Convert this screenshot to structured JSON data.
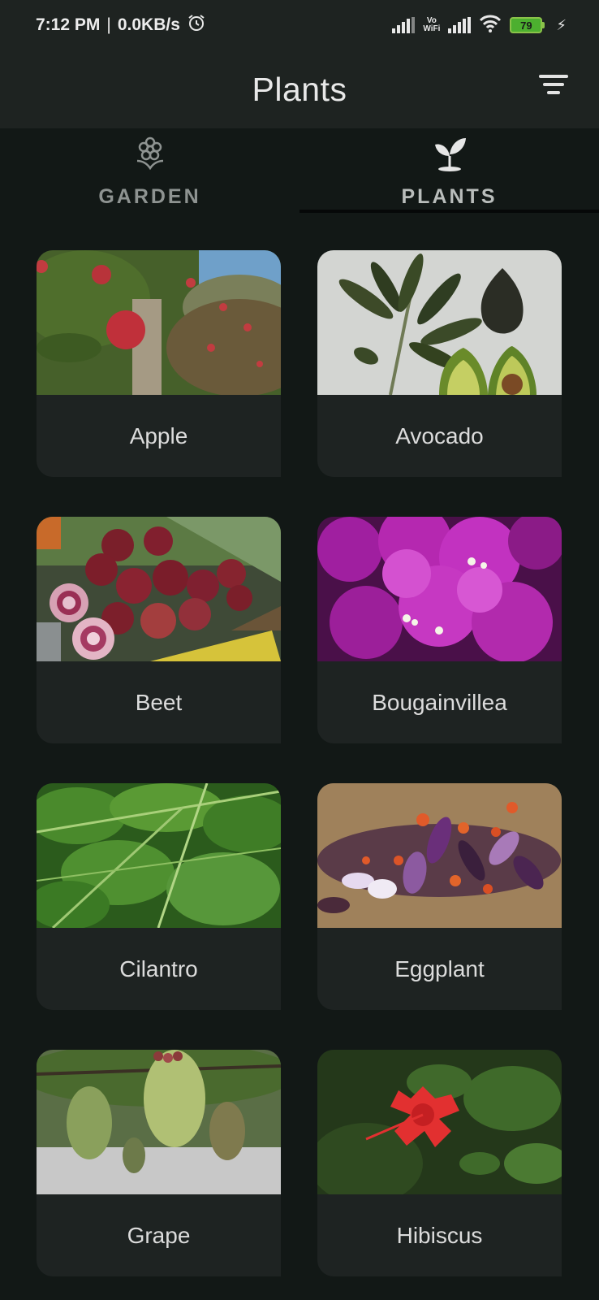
{
  "status_bar": {
    "time": "7:12 PM",
    "separator": "|",
    "network_speed": "0.0KB/s",
    "volte_top": "Vo",
    "volte_bottom": "WiFi",
    "battery_level": "79",
    "icons": [
      "alarm-icon",
      "signal-icon",
      "wifi-icon",
      "battery-icon",
      "charging-icon"
    ]
  },
  "app_bar": {
    "title": "Plants",
    "filter_icon": "filter-list-icon"
  },
  "tabs": [
    {
      "label": "GARDEN",
      "icon": "flower-icon",
      "active": false
    },
    {
      "label": "PLANTS",
      "icon": "sprout-icon",
      "active": true
    }
  ],
  "plants": [
    {
      "name": "Apple"
    },
    {
      "name": "Avocado"
    },
    {
      "name": "Beet"
    },
    {
      "name": "Bougainvillea"
    },
    {
      "name": "Cilantro"
    },
    {
      "name": "Eggplant"
    },
    {
      "name": "Grape"
    },
    {
      "name": "Hibiscus"
    }
  ],
  "colors": {
    "background": "#121816",
    "bar": "#1e2321",
    "card": "#1e2322",
    "text": "#dcdcdc",
    "battery": "#4caf2f"
  }
}
